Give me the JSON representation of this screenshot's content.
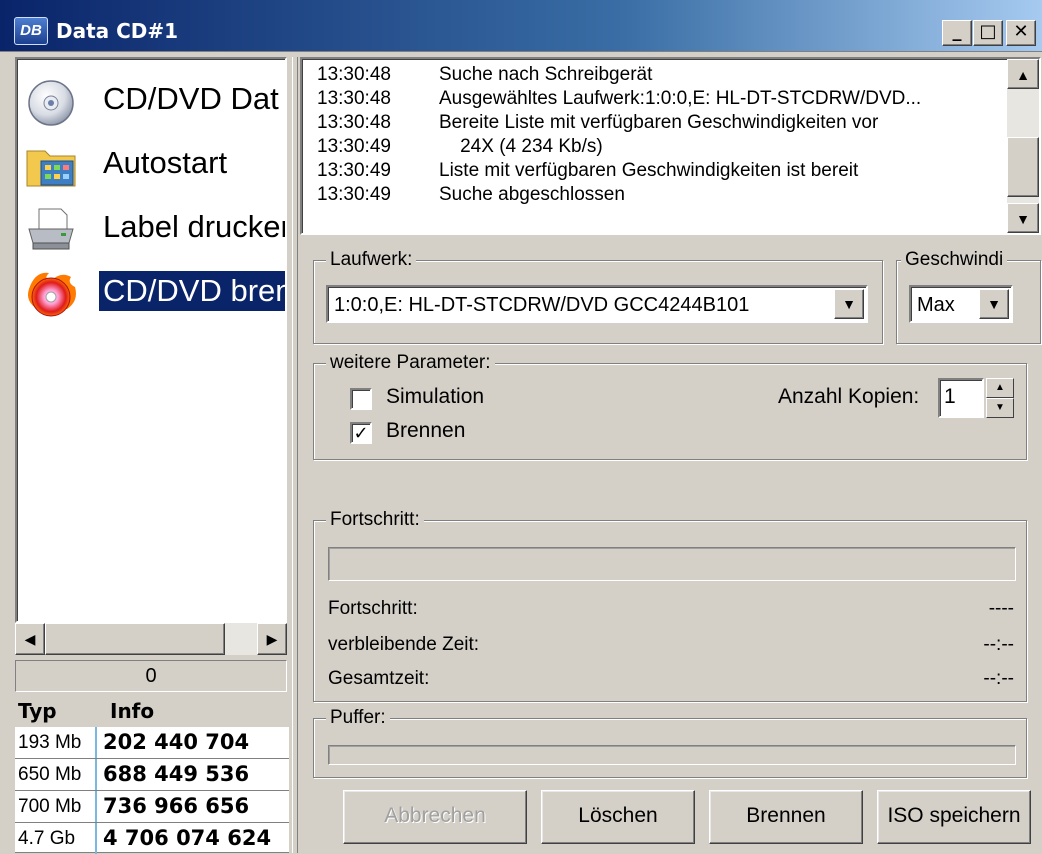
{
  "window": {
    "icon_text": "DB",
    "title": "Data CD#1",
    "minimize": "_",
    "maximize": "□",
    "close": "✕"
  },
  "nav": {
    "items": [
      {
        "label": "CD/DVD Dat",
        "icon": "cd-disc-icon"
      },
      {
        "label": "Autostart",
        "icon": "folder-icon"
      },
      {
        "label": "Label drucker",
        "icon": "printer-icon"
      },
      {
        "label": "CD/DVD bren",
        "icon": "burn-disc-icon",
        "selected": true
      }
    ]
  },
  "counter": "0",
  "size_table": {
    "headers": [
      "Typ",
      "Info"
    ],
    "rows": [
      {
        "typ": "193 Mb",
        "info": "202 440 704"
      },
      {
        "typ": "650 Mb",
        "info": "688 449 536"
      },
      {
        "typ": "700 Mb",
        "info": "736 966 656"
      },
      {
        "typ": "4.7 Gb",
        "info": "4 706 074 624"
      }
    ]
  },
  "log": {
    "entries": [
      {
        "time": "13:30:48",
        "msg": "Suche nach Schreibgerät"
      },
      {
        "time": "13:30:48",
        "msg": "Ausgewähltes Laufwerk:1:0:0,E: HL-DT-STCDRW/DVD..."
      },
      {
        "time": "13:30:48",
        "msg": "Bereite Liste mit verfügbaren Geschwindigkeiten vor"
      },
      {
        "time": "13:30:49",
        "msg": "    24X (4 234 Kb/s)"
      },
      {
        "time": "13:30:49",
        "msg": "Liste mit verfügbaren Geschwindigkeiten ist bereit"
      },
      {
        "time": "13:30:49",
        "msg": "Suche abgeschlossen"
      }
    ]
  },
  "drive": {
    "label": "Laufwerk:",
    "value": "1:0:0,E: HL-DT-STCDRW/DVD GCC4244B101"
  },
  "speed": {
    "label": "Geschwindi",
    "value": "Max"
  },
  "params": {
    "label": "weitere Parameter:",
    "simulation_label": "Simulation",
    "simulation_checked": false,
    "burn_label": "Brennen",
    "burn_checked": true,
    "copies_label": "Anzahl Kopien:",
    "copies_value": "1"
  },
  "progress": {
    "label": "Fortschritt:",
    "fraction": 0,
    "rows": [
      {
        "label": "Fortschritt:",
        "value": "----"
      },
      {
        "label": "verbleibende Zeit:",
        "value": "--:--"
      },
      {
        "label": "Gesamtzeit:",
        "value": "--:--"
      }
    ]
  },
  "buffer": {
    "label": "Puffer:",
    "fraction": 0
  },
  "buttons": {
    "cancel": "Abbrechen",
    "clear": "Löschen",
    "burn": "Brennen",
    "save_iso": "ISO speichern"
  },
  "colors": {
    "selection": "#0a246a",
    "face": "#d4d0c8"
  }
}
